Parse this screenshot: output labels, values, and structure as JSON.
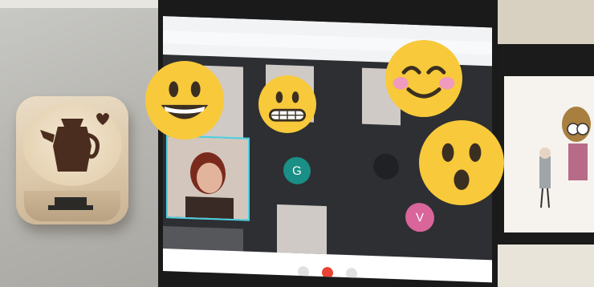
{
  "scene": {
    "left_photo": {
      "subject": "wooden-die-coffee-pot"
    },
    "call": {
      "participants": [
        {
          "initial": "G",
          "color": "#1a8f85"
        },
        {
          "initial": "V",
          "color": "#d9659b"
        }
      ]
    },
    "emojis": [
      "grinning-face",
      "grimacing-face",
      "smiling-face-blush",
      "astonished-face"
    ]
  }
}
